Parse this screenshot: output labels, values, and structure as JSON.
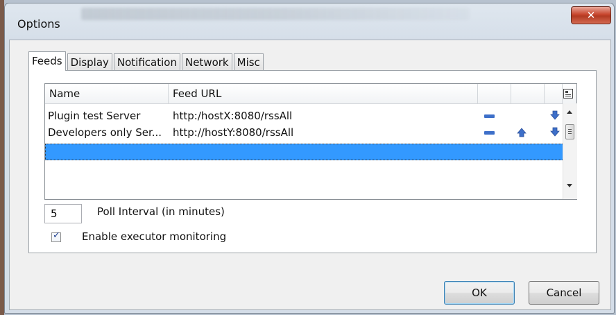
{
  "window": {
    "title": "Options",
    "close_glyph": "✕"
  },
  "tabs": [
    {
      "label": "Feeds",
      "active": true
    },
    {
      "label": "Display"
    },
    {
      "label": "Notification"
    },
    {
      "label": "Network"
    },
    {
      "label": "Misc"
    }
  ],
  "table": {
    "columns": [
      "Name",
      "Feed URL"
    ],
    "rows": [
      {
        "name": "Plugin test Server",
        "url": "http:/hostX:8080/rssAll",
        "actions": [
          "remove-icon",
          "move-down-icon"
        ]
      },
      {
        "name": "Developers only Ser...",
        "url": "http://hostY:8080/rssAll",
        "actions": [
          "remove-icon",
          "move-up-icon",
          "move-down-icon"
        ]
      }
    ],
    "config_icon": "column-config-icon"
  },
  "poll": {
    "value": "5",
    "label": "Poll Interval (in minutes)"
  },
  "monitoring": {
    "label": "Enable executor monitoring",
    "checked": true,
    "check_glyph": "✓"
  },
  "buttons": {
    "ok": "OK",
    "cancel": "Cancel"
  },
  "colors": {
    "selection": "#3399ff",
    "icon_blue": "#3d6fc9",
    "close_red": "#c8462e"
  }
}
